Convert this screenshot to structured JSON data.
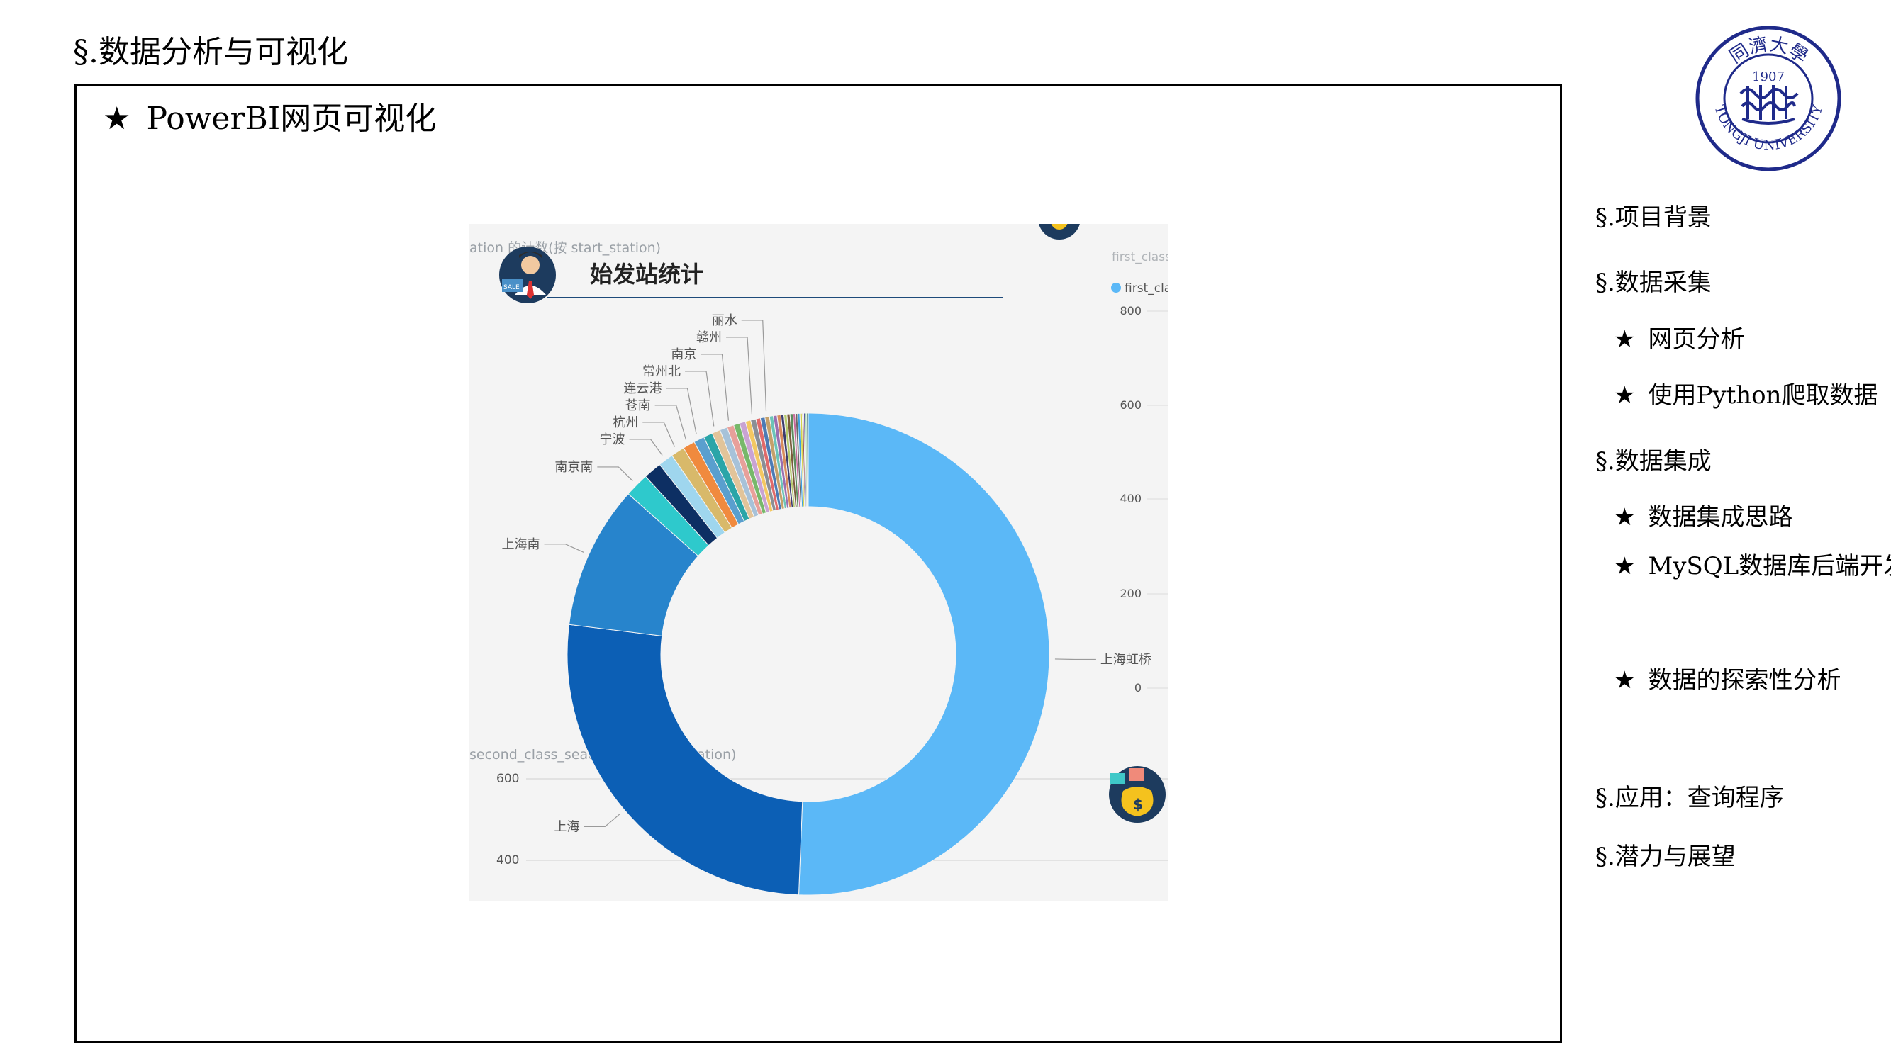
{
  "page": {
    "title": "§.数据分析与可视化",
    "section_heading_star": "★",
    "section_heading": "PowerBI网页可视化"
  },
  "logo": {
    "text_top": "同濟大學",
    "year": "1907",
    "text_bottom": "TONGJI UNIVERSITY",
    "color": "#1f2a8a"
  },
  "toc": [
    {
      "label": "§.项目背景",
      "level": 0
    },
    {
      "label": "§.数据采集",
      "level": 0
    },
    {
      "label": "网页分析",
      "level": 1
    },
    {
      "label": "使用Python爬取数据",
      "level": 1
    },
    {
      "label": "§.数据集成",
      "level": 0
    },
    {
      "label": "数据集成思路",
      "level": 1
    },
    {
      "label": "MySQL数据库后端开发",
      "level": 1
    },
    {
      "label": "数据的探索性分析",
      "level": 1
    },
    {
      "label": "§.应用：查询程序",
      "level": 0
    },
    {
      "label": "§.潜力与展望",
      "level": 0
    }
  ],
  "toc_star": "★",
  "powerbi": {
    "top_chart_caption": "ation 的计数(按 start_station)",
    "bottom_chart_caption": "second_class_seat 的平均值(按 duration)",
    "bottom_axis_label": "second_class_seat",
    "bottom_axis_ticks": [
      "600",
      "400"
    ],
    "right_legend_title": "first_class",
    "right_legend_item": "first_clas",
    "right_axis_ticks": [
      "800",
      "600",
      "400",
      "200",
      "0"
    ],
    "card_icon": "money-bag-icon",
    "avatar_icon": "salesman-avatar-icon",
    "avatar_sign": "SALE"
  },
  "chart_data": {
    "type": "pie",
    "variant": "donut",
    "title": "始发站统计",
    "legend": "none",
    "labels_visible": [
      "上海虹桥",
      "上海",
      "上海南",
      "南京南",
      "宁波",
      "杭州",
      "苍南",
      "连云港",
      "常州北",
      "南京",
      "赣州",
      "丽水"
    ],
    "slices": [
      {
        "label": "上海虹桥",
        "value": 50.0,
        "color": "#5bb8f7"
      },
      {
        "label": "上海",
        "value": 26.0,
        "color": "#0c5fb5"
      },
      {
        "label": "上海南",
        "value": 9.5,
        "color": "#2784cc"
      },
      {
        "label": "南京南",
        "value": 1.6,
        "color": "#2ec9cc"
      },
      {
        "label": "",
        "value": 1.2,
        "color": "#0d2f63"
      },
      {
        "label": "宁波",
        "value": 1.0,
        "color": "#9fd6ee"
      },
      {
        "label": "杭州",
        "value": 0.9,
        "color": "#d8b96a"
      },
      {
        "label": "苍南",
        "value": 0.8,
        "color": "#f08a3e"
      },
      {
        "label": "连云港",
        "value": 0.7,
        "color": "#5a9fce"
      },
      {
        "label": "",
        "value": 0.6,
        "color": "#2aa5a8"
      },
      {
        "label": "常州北",
        "value": 0.55,
        "color": "#e2c49a"
      },
      {
        "label": "",
        "value": 0.5,
        "color": "#a7c2d9"
      },
      {
        "label": "南京",
        "value": 0.45,
        "color": "#e8a09a"
      },
      {
        "label": "",
        "value": 0.4,
        "color": "#77b86a"
      },
      {
        "label": "",
        "value": 0.4,
        "color": "#c9a3d3"
      },
      {
        "label": "",
        "value": 0.35,
        "color": "#f4c862"
      },
      {
        "label": "赣州",
        "value": 0.35,
        "color": "#8a8f96"
      },
      {
        "label": "",
        "value": 0.3,
        "color": "#e06a6a"
      },
      {
        "label": "",
        "value": 0.3,
        "color": "#4c7bb5"
      },
      {
        "label": "丽水",
        "value": 0.3,
        "color": "#c5a06a"
      },
      {
        "label": "",
        "value": 0.25,
        "color": "#6bc4b8"
      },
      {
        "label": "",
        "value": 0.25,
        "color": "#9a6fb0"
      },
      {
        "label": "",
        "value": 0.25,
        "color": "#d98c5c"
      },
      {
        "label": "",
        "value": 0.2,
        "color": "#3c3c6e"
      },
      {
        "label": "",
        "value": 0.2,
        "color": "#b5c96a"
      },
      {
        "label": "",
        "value": 0.2,
        "color": "#7a5a3c"
      },
      {
        "label": "",
        "value": 0.2,
        "color": "#5c8c5c"
      },
      {
        "label": "",
        "value": 0.15,
        "color": "#c86a9a"
      },
      {
        "label": "",
        "value": 0.15,
        "color": "#6a6a6a"
      },
      {
        "label": "",
        "value": 0.15,
        "color": "#3ca0e0"
      },
      {
        "label": "",
        "value": 0.15,
        "color": "#d4d44a"
      },
      {
        "label": "",
        "value": 0.1,
        "color": "#8c3c3c"
      },
      {
        "label": "",
        "value": 0.1,
        "color": "#4a4a9a"
      },
      {
        "label": "",
        "value": 0.1,
        "color": "#9ad4a0"
      },
      {
        "label": "",
        "value": 0.1,
        "color": "#2c6c6c"
      }
    ]
  }
}
